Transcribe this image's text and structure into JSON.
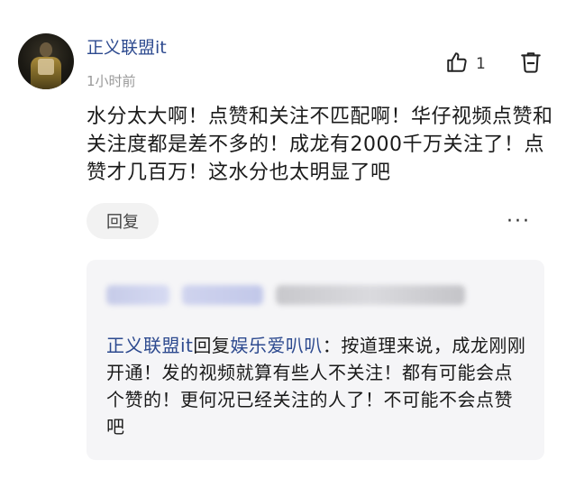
{
  "comment": {
    "username": "正义联盟it",
    "timestamp": "1小时前",
    "like_count": "1",
    "text": "水分太大啊！点赞和关注不匹配啊！华仔视频点赞和关注度都是差不多的！成龙有2000千万关注了！点赞才几百万！这水分也太明显了吧",
    "reply_button_label": "回复",
    "more_label": "···",
    "icons": [
      "thumbs-up-icon",
      "trash-icon",
      "more-icon"
    ]
  },
  "reply_preview": {
    "author": "正义联盟it",
    "reply_word": "回复",
    "target": "娱乐爱叭叭",
    "text": "：按道理来说，成龙刚刚开通！发的视频就算有些人不关注！都有可能会点个赞的！更何况已经关注的人了！不可能不会点赞吧"
  },
  "colors": {
    "username": "#2d4a8f",
    "timestamp": "#999999",
    "reply_box_bg": "#f5f5f7"
  }
}
